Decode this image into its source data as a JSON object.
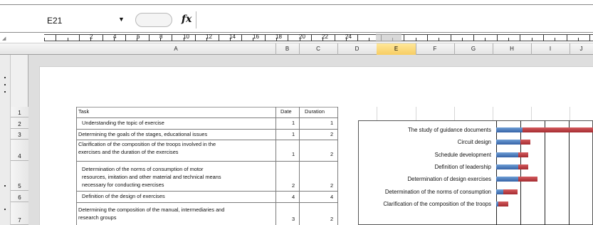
{
  "formula_bar": {
    "name_box": "E21",
    "fx_label": "fx",
    "formula_value": ""
  },
  "ruler": {
    "numbers": [
      "2",
      "4",
      "6",
      "8",
      "10",
      "12",
      "14",
      "16",
      "18",
      "20",
      "22",
      "24"
    ]
  },
  "columns": [
    "A",
    "B",
    "C",
    "D",
    "E",
    "F",
    "G",
    "H",
    "I",
    "J"
  ],
  "selected_column": "E",
  "rows": [
    "1",
    "2",
    "3",
    "4",
    "5",
    "6",
    "7"
  ],
  "table": {
    "headers": {
      "task": "Task",
      "date": "Date",
      "duration": "Duration"
    },
    "tasks": [
      {
        "task": "Understanding the topic of   exercise",
        "date": "1",
        "duration": "1"
      },
      {
        "task": "Determining the goals of the stages, educational issues",
        "date": "1",
        "duration": "2"
      },
      {
        "task_lines": [
          "Clarification of the composition of the troops involved in the",
          "exercises and the duration of the exercises"
        ],
        "date": "1",
        "duration": "2"
      },
      {
        "task_lines": [
          "Determination of the norms of consumption of motor",
          "resources, imitation and other material and technical  means",
          "necessary for conducting exercises"
        ],
        "date": "2",
        "duration": "2"
      },
      {
        "task": "Definition of the design of exercises",
        "date": "4",
        "duration": "4"
      },
      {
        "task_lines": [
          "Determining the composition of the manual,  intermediaries and",
          "research groups"
        ],
        "date": "3",
        "duration": "2"
      }
    ]
  },
  "chart_data": {
    "type": "bar",
    "orientation": "horizontal",
    "stacked": true,
    "categories": [
      "The study of guidance documents",
      "Circuit design",
      "Schedule development",
      "Definition of leadership",
      "Determination of design exercises",
      "Determination of the norms of consumption",
      "Clarification of the composition of the troops"
    ],
    "series": [
      {
        "values": [
          1.1,
          1.0,
          0.9,
          0.9,
          0.9,
          0.3,
          0.1
        ],
        "color": "#3f6fb4"
      },
      {
        "values": [
          2.9,
          0.4,
          0.4,
          0.4,
          0.8,
          0.6,
          0.4
        ],
        "color": "#b53439"
      }
    ],
    "grid": true,
    "legend": "none"
  }
}
